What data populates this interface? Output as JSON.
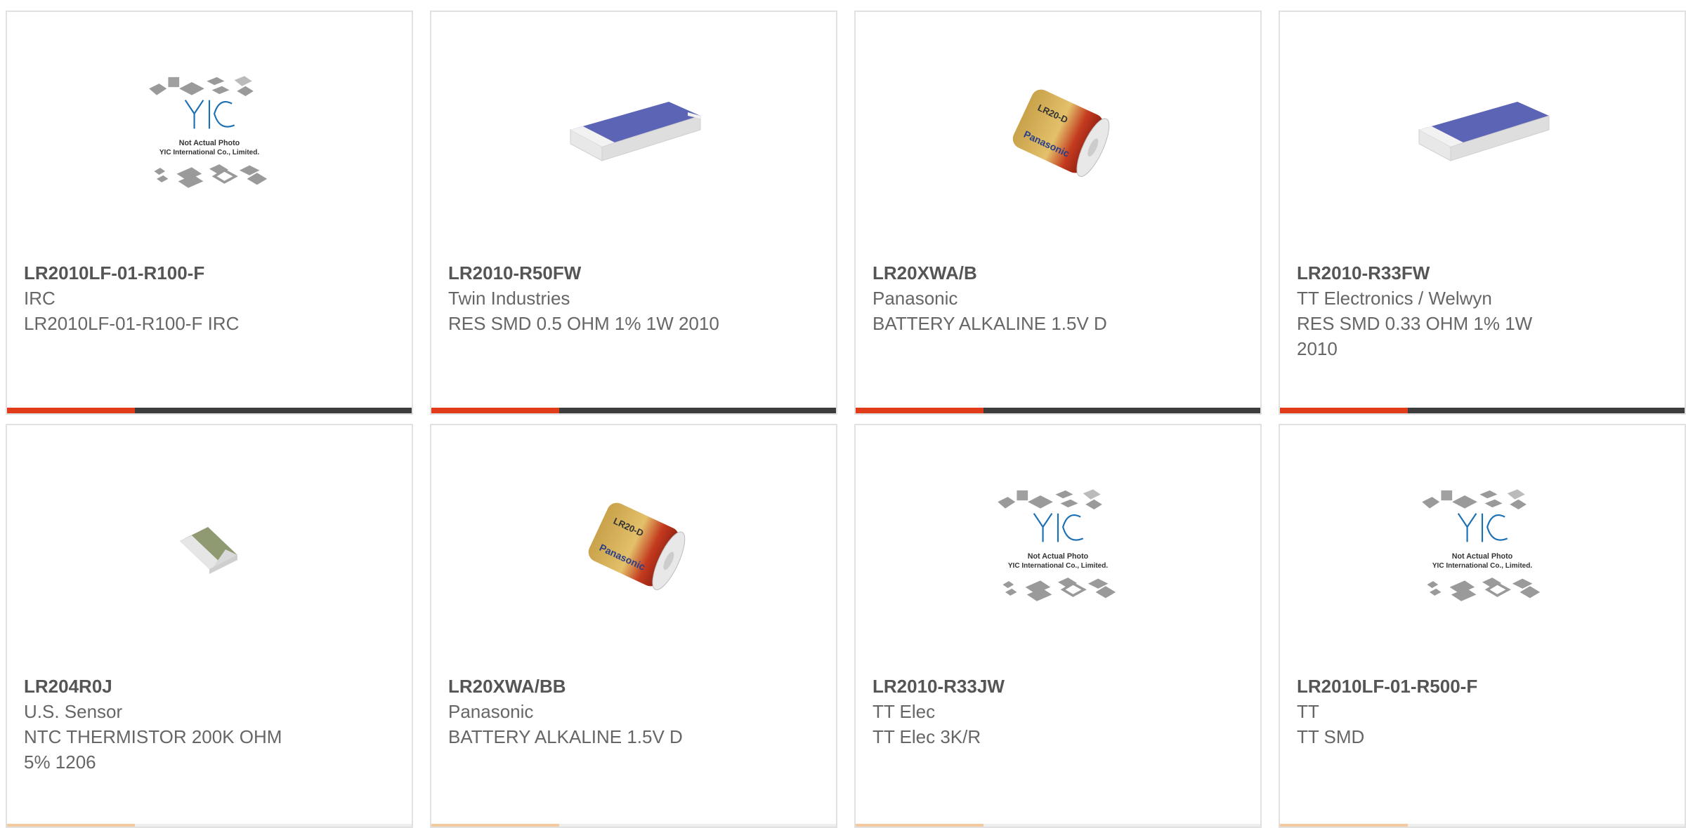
{
  "products": [
    {
      "part": "LR2010LF-01-R100-F",
      "manufacturer": "IRC",
      "description": "LR2010LF-01-R100-F IRC",
      "image": "yic-placeholder",
      "placeholder_line1": "Not Actual Photo",
      "placeholder_line2": "YIC International Co., Limited."
    },
    {
      "part": "LR2010-R50FW",
      "manufacturer": "Twin Industries",
      "description": "RES SMD 0.5 OHM 1% 1W 2010",
      "image": "resistor-chip"
    },
    {
      "part": "LR20XWA/B",
      "manufacturer": "Panasonic",
      "description": "BATTERY ALKALINE 1.5V D",
      "image": "battery",
      "battery_label": "LR20-D",
      "battery_brand": "Panasonic"
    },
    {
      "part": "LR2010-R33FW",
      "manufacturer": "TT Electronics / Welwyn",
      "description": "RES SMD 0.33 OHM 1% 1W 2010",
      "image": "resistor-chip"
    },
    {
      "part": "LR204R0J",
      "manufacturer": "U.S. Sensor",
      "description": "NTC THERMISTOR 200K OHM 5% 1206",
      "image": "thermistor"
    },
    {
      "part": "LR20XWA/BB",
      "manufacturer": "Panasonic",
      "description": "BATTERY ALKALINE 1.5V D",
      "image": "battery",
      "battery_label": "LR20-D",
      "battery_brand": "Panasonic"
    },
    {
      "part": "LR2010-R33JW",
      "manufacturer": "TT Elec",
      "description": "TT Elec 3K/R",
      "image": "yic-placeholder",
      "placeholder_line1": "Not Actual Photo",
      "placeholder_line2": "YIC International Co., Limited."
    },
    {
      "part": "LR2010LF-01-R500-F",
      "manufacturer": "TT",
      "description": "TT SMD",
      "image": "yic-placeholder",
      "placeholder_line1": "Not Actual Photo",
      "placeholder_line2": "YIC International Co., Limited."
    }
  ],
  "colors": {
    "accent": "#e13c1a",
    "bar": "#3d3d3d",
    "border": "#e1e1e1",
    "resistor_top": "#5b64b5"
  },
  "logo_text": "YIC"
}
